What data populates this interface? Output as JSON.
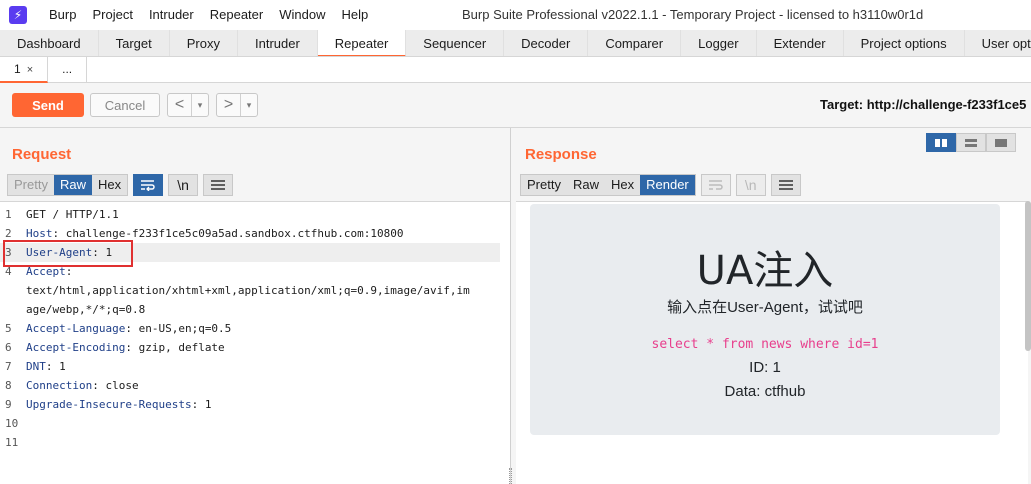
{
  "menu": [
    "Burp",
    "Project",
    "Intruder",
    "Repeater",
    "Window",
    "Help"
  ],
  "window_title": "Burp Suite Professional v2022.1.1 - Temporary Project - licensed to h3110w0r1d",
  "tool_tabs": [
    "Dashboard",
    "Target",
    "Proxy",
    "Intruder",
    "Repeater",
    "Sequencer",
    "Decoder",
    "Comparer",
    "Logger",
    "Extender",
    "Project options",
    "User options"
  ],
  "active_tool_tab": "Repeater",
  "sub_tabs": [
    {
      "label": "1",
      "close": "×"
    },
    {
      "label": "..."
    }
  ],
  "toolbar": {
    "send": "Send",
    "cancel": "Cancel",
    "back": "<",
    "forward": ">",
    "dropdown": "▾",
    "target": "Target: http://challenge-f233f1ce5"
  },
  "request": {
    "title": "Request",
    "formats": [
      "Pretty",
      "Raw",
      "Hex"
    ],
    "active_format": "Raw",
    "wrap_icon": "wrap-icon",
    "newline_label": "\\n",
    "menu_icon": "hamburger-icon",
    "lines": [
      {
        "n": "1",
        "key": "",
        "val": "GET / HTTP/1.1"
      },
      {
        "n": "2",
        "key": "Host",
        "val": ": challenge-f233f1ce5c09a5ad.sandbox.ctfhub.com:10800"
      },
      {
        "n": "3",
        "key": "User-Agent",
        "val": ": 1"
      },
      {
        "n": "4",
        "key": "Accept",
        "val": ":"
      },
      {
        "n": "",
        "key": "",
        "val": "text/html,application/xhtml+xml,application/xml;q=0.9,image/avif,im"
      },
      {
        "n": "",
        "key": "",
        "val": "age/webp,*/*;q=0.8"
      },
      {
        "n": "5",
        "key": "Accept-Language",
        "val": ": en-US,en;q=0.5"
      },
      {
        "n": "6",
        "key": "Accept-Encoding",
        "val": ": gzip, deflate"
      },
      {
        "n": "7",
        "key": "DNT",
        "val": ": 1"
      },
      {
        "n": "8",
        "key": "Connection",
        "val": ": close"
      },
      {
        "n": "9",
        "key": "Upgrade-Insecure-Requests",
        "val": ": 1"
      },
      {
        "n": "10",
        "key": "",
        "val": ""
      },
      {
        "n": "11",
        "key": "",
        "val": ""
      }
    ]
  },
  "response": {
    "title": "Response",
    "formats": [
      "Pretty",
      "Raw",
      "Hex",
      "Render"
    ],
    "active_format": "Render",
    "newline_label": "\\n",
    "render": {
      "heading": "UA注入",
      "subtitle": "输入点在User-Agent，试试吧",
      "sql": "select * from news where id=1",
      "id_line": "ID: 1",
      "data_line": "Data: ctfhub"
    }
  },
  "colors": {
    "accent": "#ff6633",
    "active_blue": "#2e67a8",
    "highlight_box": "#e03030",
    "sql_pink": "#e83e8c"
  }
}
